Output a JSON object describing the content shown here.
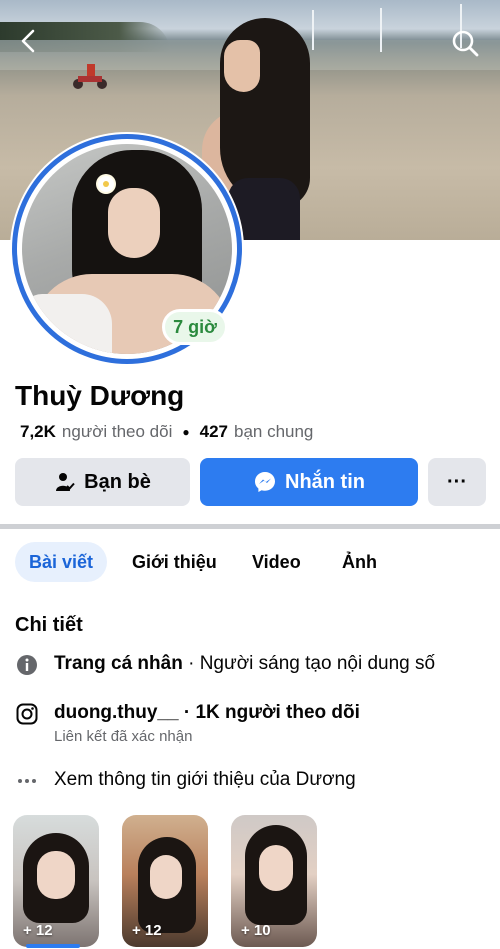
{
  "profile": {
    "name": "Thuỳ Dương",
    "story_badge": "7 giờ",
    "followers_count": "7,2K",
    "followers_label": "người theo dõi",
    "mutual_count": "427",
    "mutual_label": "bạn chung"
  },
  "actions": {
    "friends_label": "Bạn bè",
    "message_label": "Nhắn tin",
    "more_label": "···"
  },
  "tabs": [
    {
      "label": "Bài viết",
      "active": true
    },
    {
      "label": "Giới thiệu",
      "active": false
    },
    {
      "label": "Video",
      "active": false
    },
    {
      "label": "Ảnh",
      "active": false
    }
  ],
  "details": {
    "title": "Chi tiết",
    "page_label": "Trang cá nhân",
    "page_category": " · Người sáng tạo nội dung số",
    "instagram_handle": "duong.thuy__",
    "instagram_followers": " · 1K người theo dõi",
    "instagram_sub": "Liên kết đã xác nhận",
    "see_more": "Xem thông tin giới thiệu của Dương"
  },
  "featured": [
    {
      "count": "+ 12"
    },
    {
      "count": "+ 12"
    },
    {
      "count": "+ 10"
    }
  ],
  "colors": {
    "accent": "#2d7cf0",
    "button_gray": "#e4e6eb",
    "story_green": "#2b8a3e"
  },
  "icons": [
    "back-icon",
    "search-icon",
    "friend-check-icon",
    "messenger-icon",
    "info-icon",
    "instagram-icon",
    "more-dots-icon"
  ]
}
